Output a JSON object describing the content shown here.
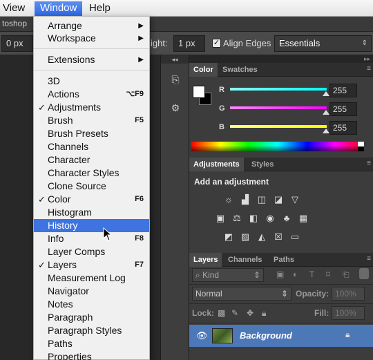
{
  "menubar": {
    "view": "View",
    "window": "Window",
    "help": "Help"
  },
  "app": {
    "title_fragment": "toshop"
  },
  "options": {
    "field_value": "0 px",
    "height_label": "ight:",
    "height_value": "1 px",
    "align_edges": "Align Edges",
    "workspace": "Essentials"
  },
  "window_menu": {
    "arrange": "Arrange",
    "workspace": "Workspace",
    "extensions": "Extensions",
    "items": {
      "3d": "3D",
      "actions": "Actions",
      "actions_sc": "⌥F9",
      "adjustments": "Adjustments",
      "brush": "Brush",
      "brush_sc": "F5",
      "brush_presets": "Brush Presets",
      "channels": "Channels",
      "character": "Character",
      "character_styles": "Character Styles",
      "clone_source": "Clone Source",
      "color": "Color",
      "color_sc": "F6",
      "histogram": "Histogram",
      "history": "History",
      "info": "Info",
      "info_sc": "F8",
      "layer_comps": "Layer Comps",
      "layers": "Layers",
      "layers_sc": "F7",
      "measurement_log": "Measurement Log",
      "navigator": "Navigator",
      "notes": "Notes",
      "paragraph": "Paragraph",
      "paragraph_styles": "Paragraph Styles",
      "paths": "Paths",
      "properties": "Properties"
    }
  },
  "color_panel": {
    "tab_color": "Color",
    "tab_swatches": "Swatches",
    "r_label": "R",
    "g_label": "G",
    "b_label": "B",
    "r_value": "255",
    "g_value": "255",
    "b_value": "255"
  },
  "adjustments_panel": {
    "tab_adjustments": "Adjustments",
    "tab_styles": "Styles",
    "heading": "Add an adjustment"
  },
  "layers_panel": {
    "tab_layers": "Layers",
    "tab_channels": "Channels",
    "tab_paths": "Paths",
    "kind": "Kind",
    "blend_mode": "Normal",
    "opacity_label": "Opacity:",
    "opacity_value": "100%",
    "lock_label": "Lock:",
    "fill_label": "Fill:",
    "fill_value": "100%",
    "layer_name": "Background"
  }
}
